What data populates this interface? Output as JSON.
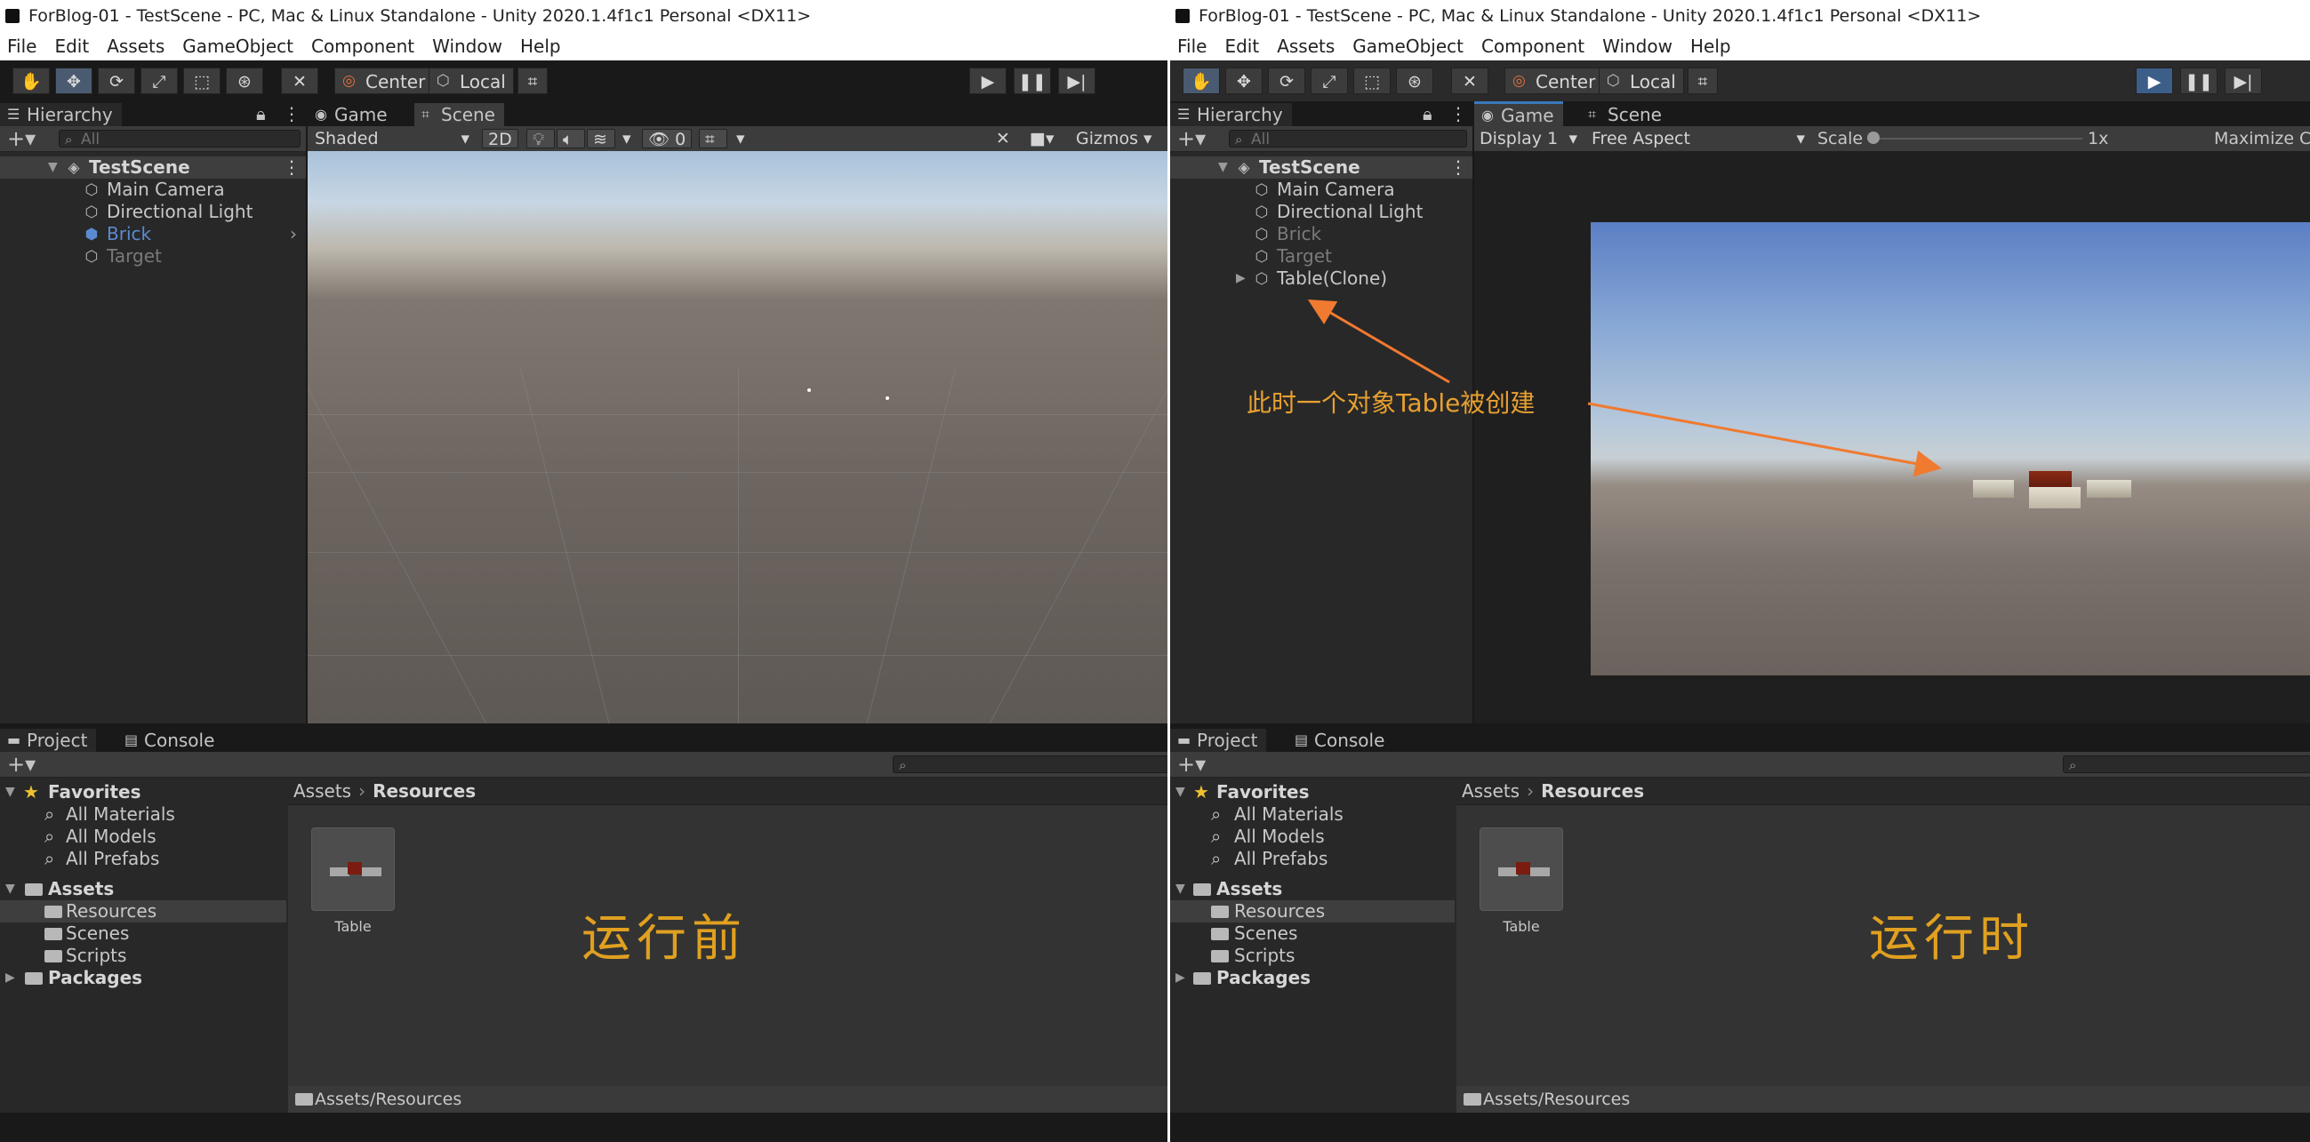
{
  "left": {
    "title": "ForBlog-01 - TestScene - PC, Mac & Linux Standalone - Unity 2020.1.4f1c1 Personal <DX11>",
    "menu": [
      "File",
      "Edit",
      "Assets",
      "GameObject",
      "Component",
      "Window",
      "Help"
    ],
    "toolbar": {
      "center_label": "Center",
      "local_label": "Local",
      "play_active": false
    },
    "hierarchy": {
      "tab": "Hierarchy",
      "search_placeholder": "All",
      "scene": "TestScene",
      "items": [
        {
          "label": "Main Camera",
          "state": "normal"
        },
        {
          "label": "Directional Light",
          "state": "normal"
        },
        {
          "label": "Brick",
          "state": "prefab"
        },
        {
          "label": "Target",
          "state": "inactive"
        }
      ]
    },
    "view_tabs": [
      "Game",
      "Scene"
    ],
    "scene_toolbar": {
      "shading": "Shaded",
      "mode_2d": "2D",
      "hidden_count": "0",
      "gizmos": "Gizmos"
    },
    "project": {
      "tabs": [
        "Project",
        "Console"
      ],
      "breadcrumb": [
        "Assets",
        "Resources"
      ],
      "favorites": {
        "label": "Favorites",
        "items": [
          "All Materials",
          "All Models",
          "All Prefabs"
        ]
      },
      "assets": {
        "label": "Assets",
        "items": [
          "Resources",
          "Scenes",
          "Scripts"
        ]
      },
      "packages": "Packages",
      "asset_tile": "Table",
      "status_path": "Assets/Resources"
    },
    "note": "运行前"
  },
  "right": {
    "title": "ForBlog-01 - TestScene - PC, Mac & Linux Standalone - Unity 2020.1.4f1c1 Personal <DX11>",
    "menu": [
      "File",
      "Edit",
      "Assets",
      "GameObject",
      "Component",
      "Window",
      "Help"
    ],
    "toolbar": {
      "center_label": "Center",
      "local_label": "Local",
      "play_active": true
    },
    "hierarchy": {
      "tab": "Hierarchy",
      "search_placeholder": "All",
      "scene": "TestScene",
      "items": [
        {
          "label": "Main Camera",
          "state": "normal"
        },
        {
          "label": "Directional Light",
          "state": "normal"
        },
        {
          "label": "Brick",
          "state": "inactive"
        },
        {
          "label": "Target",
          "state": "inactive"
        },
        {
          "label": "Table(Clone)",
          "state": "normal"
        }
      ]
    },
    "view_tabs": [
      "Game",
      "Scene"
    ],
    "game_toolbar": {
      "display": "Display 1",
      "aspect": "Free Aspect",
      "scale_label": "Scale",
      "scale_value": "1x",
      "maximize": "Maximize C"
    },
    "project": {
      "tabs": [
        "Project",
        "Console"
      ],
      "breadcrumb": [
        "Assets",
        "Resources"
      ],
      "favorites": {
        "label": "Favorites",
        "items": [
          "All Materials",
          "All Models",
          "All Prefabs"
        ]
      },
      "assets": {
        "label": "Assets",
        "items": [
          "Resources",
          "Scenes",
          "Scripts"
        ]
      },
      "packages": "Packages",
      "asset_tile": "Table",
      "status_path": "Assets/Resources"
    },
    "annotation": "此时一个对象Table被创建",
    "note": "运行时"
  },
  "colors": {
    "accent": "#3a79bb",
    "annotation": "#e8a030",
    "note": "#e0a020",
    "arrow": "#f07a30"
  }
}
